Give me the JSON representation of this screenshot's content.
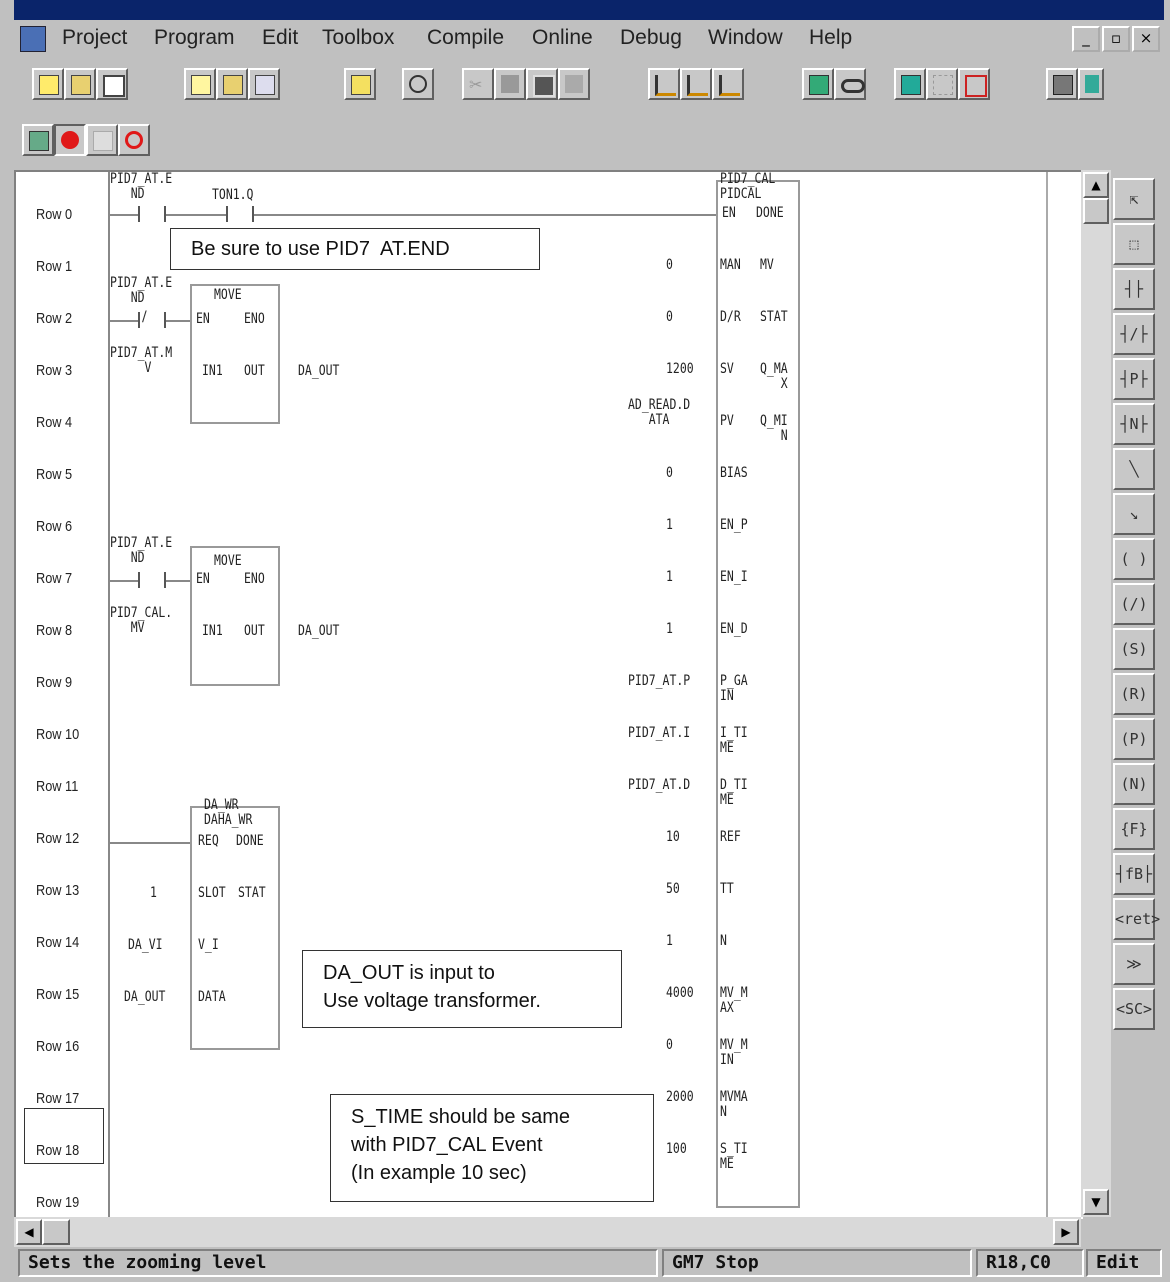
{
  "menu": {
    "items": [
      "Project",
      "Program",
      "Edit",
      "Toolbox",
      "Compile",
      "Online",
      "Debug",
      "Window",
      "Help"
    ],
    "window_controls": [
      "_",
      "▫",
      "×"
    ]
  },
  "rows": [
    "Row 0",
    "Row 1",
    "Row 2",
    "Row 3",
    "Row 4",
    "Row 5",
    "Row 6",
    "Row 7",
    "Row 8",
    "Row 9",
    "Row 10",
    "Row 11",
    "Row 12",
    "Row 13",
    "Row 14",
    "Row 15",
    "Row 16",
    "Row 17",
    "Row 18",
    "Row 19"
  ],
  "ladder": {
    "contact_r0a": "PID7_AT.E\n   ND",
    "contact_r0b": "TON1.Q",
    "contact_r1": "PID7_AT.E\n   ND",
    "move1_title": "MOVE",
    "move1_en": "EN",
    "move1_eno": "ENO",
    "move1_in": "IN1",
    "move1_out": "OUT",
    "move1_in_var": "PID7_AT.M\n     V",
    "move1_out_var": "DA_OUT",
    "contact_r6": "PID7_AT.E\n   ND",
    "move2_title": "MOVE",
    "move2_en": "EN",
    "move2_eno": "ENO",
    "move2_in": "IN1",
    "move2_out": "OUT",
    "move2_in_var": "PID7_CAL.\n   MV",
    "move2_out_var": "DA_OUT",
    "dawr_title": "DA_WR\nDAHA_WR",
    "dawr_req": "REQ",
    "dawr_done": "DONE",
    "dawr_slot": "SLOT",
    "dawr_stat": "STAT",
    "dawr_vi": "V_I",
    "dawr_data": "DATA",
    "dawr_slot_val": "1",
    "dawr_vi_val": "DA_VI",
    "dawr_data_val": "DA_OUT",
    "pid_title": "PID7_CAL\nPIDCAL",
    "pid_en": "EN",
    "pid_done": "DONE",
    "pid_inputs": [
      {
        "value": "0",
        "pin": "MAN",
        "out": "MV"
      },
      {
        "value": "0",
        "pin": "D/R",
        "out": "STAT"
      },
      {
        "value": "1200",
        "pin": "SV",
        "out": "Q_MA\n   X"
      },
      {
        "value": "AD_READ.D\n   ATA",
        "pin": "PV",
        "out": "Q_MI\n   N"
      },
      {
        "value": "0",
        "pin": "BIAS",
        "out": ""
      },
      {
        "value": "1",
        "pin": "EN_P",
        "out": ""
      },
      {
        "value": "1",
        "pin": "EN_I",
        "out": ""
      },
      {
        "value": "1",
        "pin": "EN_D",
        "out": ""
      },
      {
        "value": "PID7_AT.P",
        "pin": "P_GA\nIN",
        "out": ""
      },
      {
        "value": "PID7_AT.I",
        "pin": "I_TI\nME",
        "out": ""
      },
      {
        "value": "PID7_AT.D",
        "pin": "D_TI\nME",
        "out": ""
      },
      {
        "value": "10",
        "pin": "REF",
        "out": ""
      },
      {
        "value": "50",
        "pin": "TT",
        "out": ""
      },
      {
        "value": "1",
        "pin": "N",
        "out": ""
      },
      {
        "value": "4000",
        "pin": "MV_M\nAX",
        "out": ""
      },
      {
        "value": "0",
        "pin": "MV_M\nIN",
        "out": ""
      },
      {
        "value": "2000",
        "pin": "MVMA\nN",
        "out": ""
      },
      {
        "value": "100",
        "pin": "S_TI\nME",
        "out": ""
      }
    ]
  },
  "notes": {
    "note1": "Be sure to use PID7  AT.END",
    "note2": "DA_OUT is input to\nUse voltage transformer.",
    "note3": "S_TIME should be same\nwith PID7_CAL Event\n(In example 10 sec)"
  },
  "toolbox": [
    "⇱",
    "⬚",
    "┤├",
    "┤/├",
    "┤P├",
    "┤N├",
    "╲",
    "↘",
    "( )",
    "(/)",
    "(S)",
    "(R)",
    "(P)",
    "(N)",
    "{F}",
    "┤fB├",
    "<ret>",
    "≫",
    "<SC>"
  ],
  "status": {
    "message": "Sets the zooming level",
    "plc": "GM7 Stop",
    "position": "R18,C0",
    "mode": "Edit"
  }
}
